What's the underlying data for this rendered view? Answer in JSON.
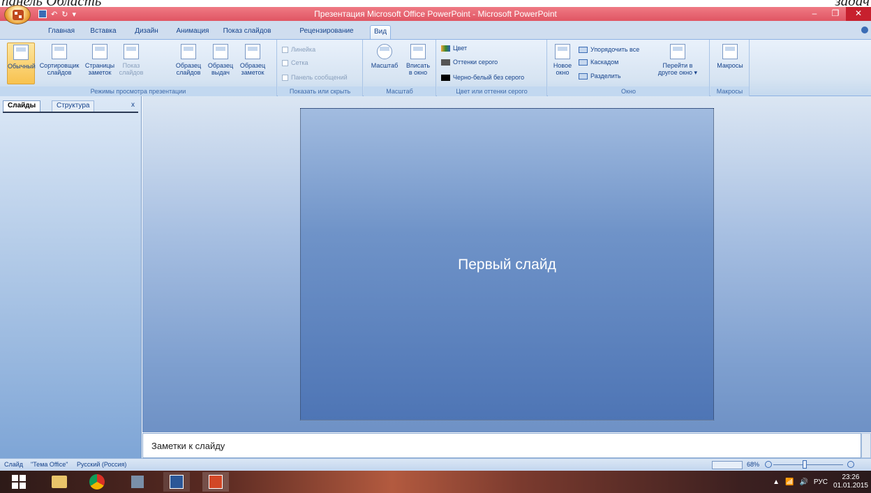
{
  "doc_context": {
    "left_text": "панель Область",
    "right_text": "задач"
  },
  "window": {
    "title": "Презентация Microsoft Office PowerPoint - Microsoft PowerPoint"
  },
  "tabs": [
    {
      "label": "Главная"
    },
    {
      "label": "Вставка"
    },
    {
      "label": "Дизайн"
    },
    {
      "label": "Анимация"
    },
    {
      "label": "Показ слайдов"
    },
    {
      "label": "Рецензирование"
    },
    {
      "label": "Вид"
    }
  ],
  "ribbon": {
    "view_modes": {
      "caption": "Режимы просмотра презентации",
      "buttons": [
        {
          "line1": "Обычный",
          "line2": ""
        },
        {
          "line1": "Сортировщик",
          "line2": "слайдов"
        },
        {
          "line1": "Страницы",
          "line2": "заметок"
        },
        {
          "line1": "Показ",
          "line2": "слайдов"
        },
        {
          "line1": "Образец",
          "line2": "слайдов"
        },
        {
          "line1": "Образец",
          "line2": "выдач"
        },
        {
          "line1": "Образец",
          "line2": "заметок"
        }
      ]
    },
    "show_hide": {
      "caption": "Показать или скрыть",
      "items": [
        {
          "label": "Линейка"
        },
        {
          "label": "Сетка"
        },
        {
          "label": "Панель сообщений"
        }
      ]
    },
    "zoom": {
      "caption": "Масштаб",
      "buttons": [
        {
          "line1": "Масштаб",
          "line2": ""
        },
        {
          "line1": "Вписать",
          "line2": "в окно"
        }
      ]
    },
    "color": {
      "caption": "Цвет или оттенки серого",
      "items": [
        {
          "label": "Цвет",
          "color": "#f4a23a"
        },
        {
          "label": "Оттенки серого",
          "color": "#555555"
        },
        {
          "label": "Черно-белый без серого",
          "color": "#000000"
        }
      ]
    },
    "window": {
      "caption": "Окно",
      "new_window": {
        "line1": "Новое",
        "line2": "окно"
      },
      "items": [
        {
          "label": "Упорядочить все"
        },
        {
          "label": "Каскадом"
        },
        {
          "label": "Разделить"
        }
      ],
      "switch": {
        "line1": "Перейти в",
        "line2": "другое окно ▾"
      }
    },
    "macros": {
      "caption": "Макросы",
      "button": {
        "line1": "Макросы"
      }
    }
  },
  "left_pane": {
    "tabs": [
      {
        "label": "Слайды"
      },
      {
        "label": "Структура"
      }
    ],
    "close": "x"
  },
  "slide": {
    "title": "Первый слайд"
  },
  "notes": {
    "placeholder": "Заметки к слайду"
  },
  "status": {
    "slide": "Слайд",
    "theme": "\"Тема Office\"",
    "language": "Русский (Россия)",
    "zoom": "68%"
  },
  "taskbar": {
    "lang": "РУС",
    "time": "23:26",
    "date": "01.01.2015"
  }
}
